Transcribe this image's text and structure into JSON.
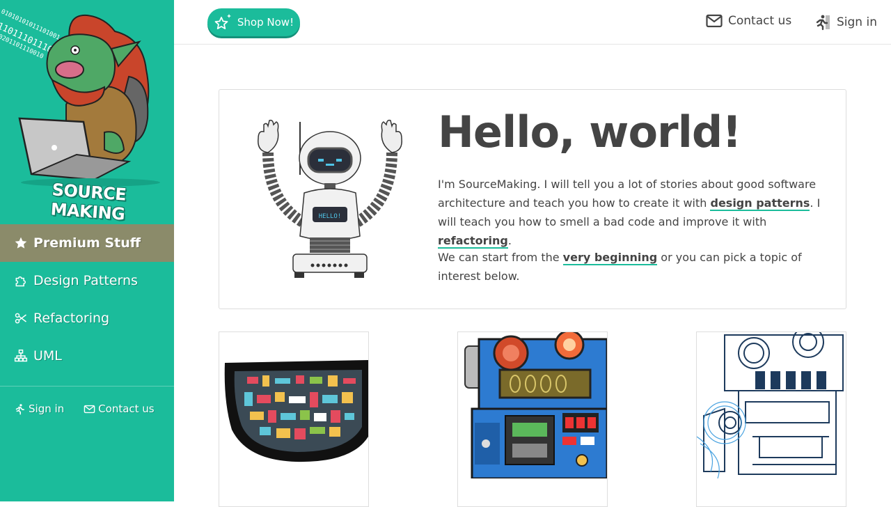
{
  "sidebar": {
    "logo_text": "SOURCE MAKING",
    "binary_lines": [
      "01010101011101001",
      "1101110111011",
      "0201101110010"
    ],
    "nav": [
      {
        "label": "Premium Stuff",
        "icon": "star-icon",
        "active": true
      },
      {
        "label": "Design Patterns",
        "icon": "puzzle-icon",
        "active": false
      },
      {
        "label": "Refactoring",
        "icon": "scissors-icon",
        "active": false
      },
      {
        "label": "UML",
        "icon": "sitemap-icon",
        "active": false
      }
    ],
    "footer_links": [
      {
        "label": "Sign in",
        "icon": "runner-icon"
      },
      {
        "label": "Contact us",
        "icon": "envelope-icon"
      }
    ]
  },
  "topbar": {
    "shop_label": "Shop Now!",
    "contact_label": "Contact us",
    "signin_label": "Sign in"
  },
  "hero": {
    "title": "Hello, world!",
    "robot_screen": "HELLO!",
    "p1_start": "I'm SourceMaking. I will tell you a lot of stories about good software architecture and teach you how to create it with ",
    "p1_link1": "design patterns",
    "p1_mid": ". I will teach you how to smell a bad code and improve it with ",
    "p1_link2": "refactoring",
    "p1_end": ".",
    "p2_start": "We can start from the ",
    "p2_link": "very beginning",
    "p2_end": " or you can pick a topic of interest below."
  },
  "colors": {
    "brand": "#1bbc9b",
    "active_nav": "#8b8b6a",
    "text": "#444444"
  }
}
